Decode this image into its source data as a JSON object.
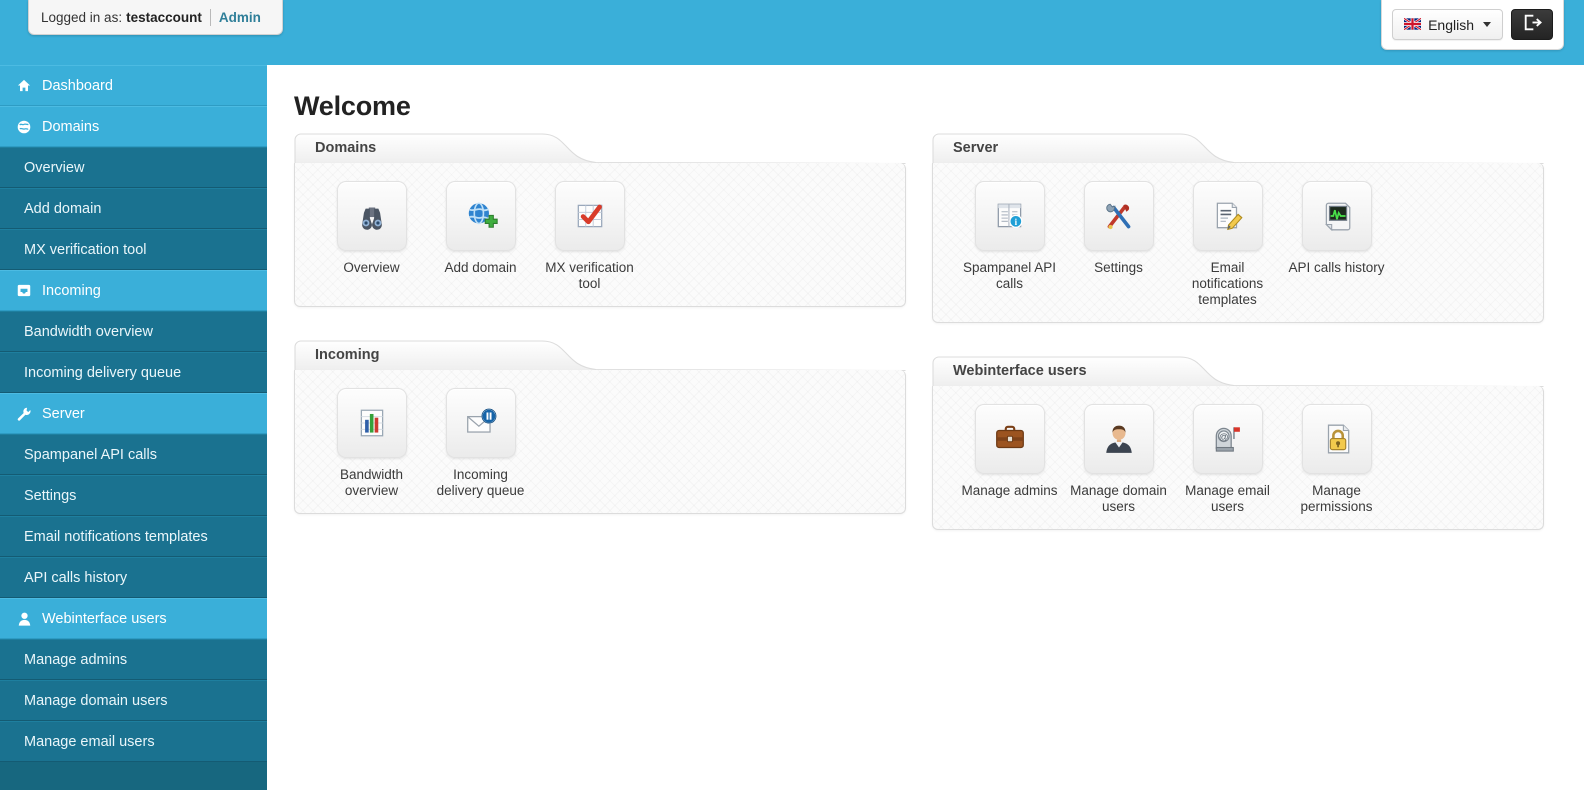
{
  "header": {
    "login_prefix": "Logged in as:",
    "account": "testaccount",
    "role_link": "Admin",
    "language": "English",
    "language_flag": "uk-flag-icon",
    "logout_icon": "logout-icon"
  },
  "sidebar": {
    "items": [
      {
        "label": "Dashboard",
        "type": "category",
        "icon": "home-icon"
      },
      {
        "label": "Domains",
        "type": "category",
        "icon": "globe-icon"
      },
      {
        "label": "Overview",
        "type": "sub"
      },
      {
        "label": "Add domain",
        "type": "sub"
      },
      {
        "label": "MX verification tool",
        "type": "sub"
      },
      {
        "label": "Incoming",
        "type": "category",
        "icon": "inbox-icon"
      },
      {
        "label": "Bandwidth overview",
        "type": "sub"
      },
      {
        "label": "Incoming delivery queue",
        "type": "sub"
      },
      {
        "label": "Server",
        "type": "category",
        "icon": "wrench-icon"
      },
      {
        "label": "Spampanel API calls",
        "type": "sub"
      },
      {
        "label": "Settings",
        "type": "sub"
      },
      {
        "label": "Email notifications templates",
        "type": "sub"
      },
      {
        "label": "API calls history",
        "type": "sub"
      },
      {
        "label": "Webinterface users",
        "type": "category",
        "icon": "user-icon"
      },
      {
        "label": "Manage admins",
        "type": "sub"
      },
      {
        "label": "Manage domain users",
        "type": "sub"
      },
      {
        "label": "Manage email users",
        "type": "sub"
      }
    ]
  },
  "main": {
    "title": "Welcome",
    "panels": [
      {
        "title": "Domains",
        "tiles": [
          {
            "label": "Overview",
            "icon": "binoculars-icon"
          },
          {
            "label": "Add domain",
            "icon": "globe-add-icon"
          },
          {
            "label": "MX verification tool",
            "icon": "checkmark-grid-icon"
          }
        ]
      },
      {
        "title": "Server",
        "tiles": [
          {
            "label": "Spampanel API calls",
            "icon": "document-info-icon"
          },
          {
            "label": "Settings",
            "icon": "tools-icon"
          },
          {
            "label": "Email notifications templates",
            "icon": "document-pencil-icon"
          },
          {
            "label": "API calls history",
            "icon": "monitor-graph-icon"
          }
        ]
      },
      {
        "title": "Incoming",
        "tiles": [
          {
            "label": "Bandwidth overview",
            "icon": "bar-chart-icon"
          },
          {
            "label": "Incoming delivery queue",
            "icon": "envelope-pause-icon"
          }
        ]
      },
      {
        "title": "Webinterface users",
        "tiles": [
          {
            "label": "Manage admins",
            "icon": "briefcase-icon"
          },
          {
            "label": "Manage domain users",
            "icon": "businessperson-icon"
          },
          {
            "label": "Manage email users",
            "icon": "mailbox-at-icon"
          },
          {
            "label": "Manage permissions",
            "icon": "padlock-document-icon"
          }
        ]
      }
    ]
  },
  "colors": {
    "header_cyan": "#3aafd9",
    "sidebar_sub": "#1a7290",
    "link_blue": "#2f7f99"
  }
}
